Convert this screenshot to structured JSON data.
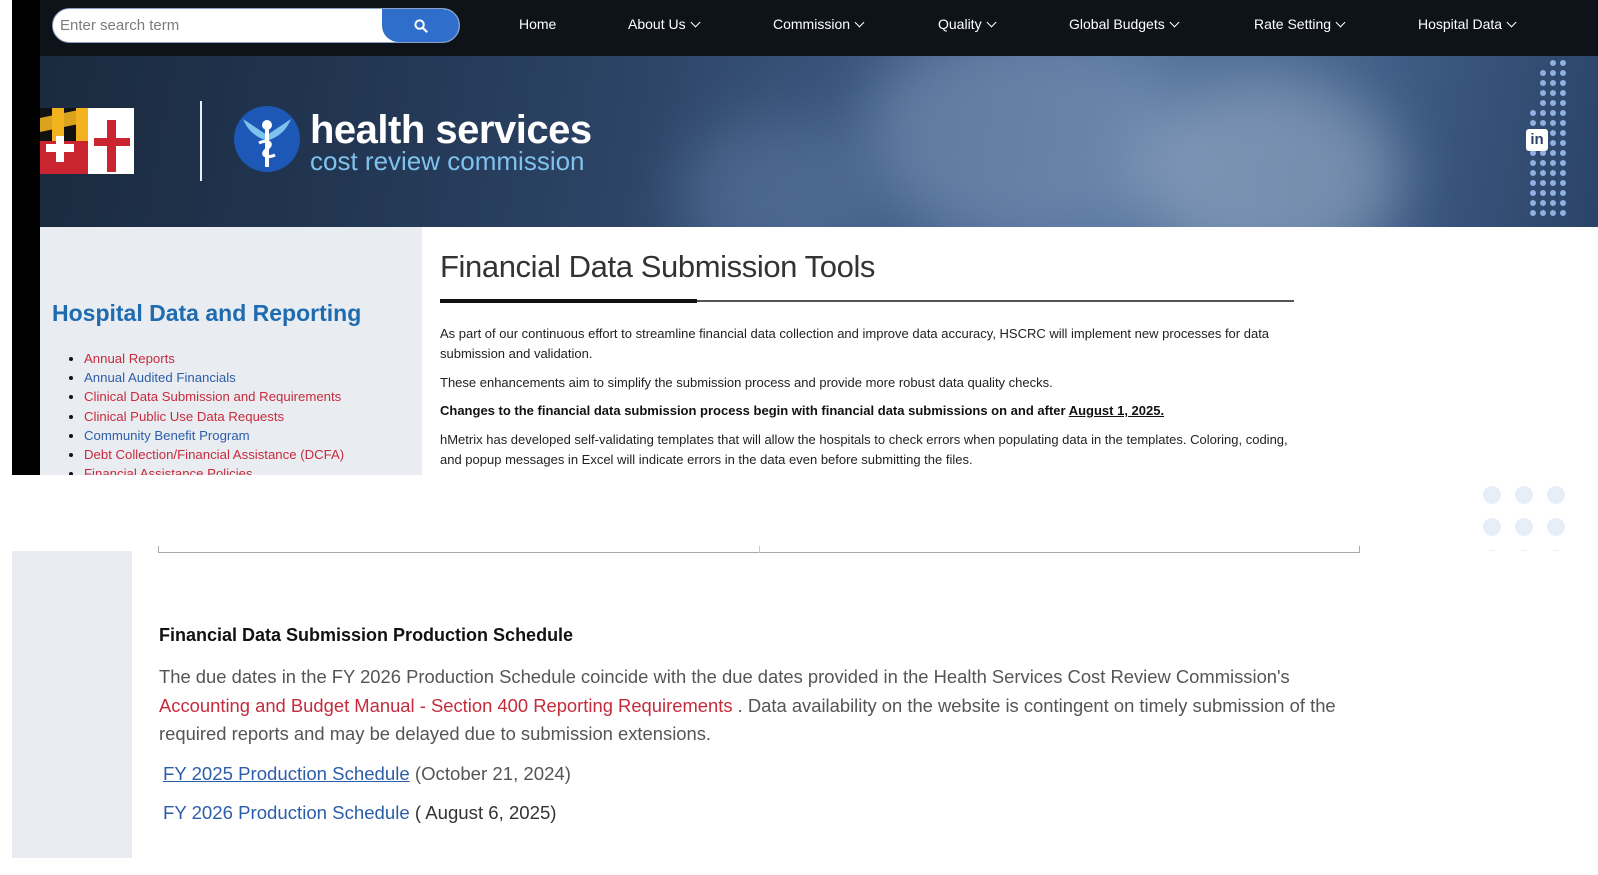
{
  "search": {
    "placeholder": "Enter search term"
  },
  "nav": {
    "items": [
      {
        "label": "Home"
      },
      {
        "label": "About Us"
      },
      {
        "label": "Commission"
      },
      {
        "label": "Quality"
      },
      {
        "label": "Global Budgets"
      },
      {
        "label": "Rate Setting"
      },
      {
        "label": "Hospital Data"
      }
    ]
  },
  "brand": {
    "main": "health services",
    "sub": "cost review commission"
  },
  "sidebar": {
    "title": "Hospital Data and Reporting",
    "items": [
      {
        "label": "Annual Reports",
        "color": "#c62b3d"
      },
      {
        "label": "Annual Audited Financials",
        "color": "#2c5ea8"
      },
      {
        "label": "Clinical Data Submission and Requirements",
        "color": "#c62b3d"
      },
      {
        "label": "Clinical Public Use Data Requests",
        "color": "#c62b3d"
      },
      {
        "label": "Community Benefit Program",
        "color": "#2c5ea8"
      },
      {
        "label": "Debt Collection/Financial Assistance (DCFA)",
        "color": "#c62b3d"
      },
      {
        "label": "Financial Assistance Policies",
        "color": "#c62b3d"
      }
    ]
  },
  "main": {
    "title": "Financial Data Submission Tools",
    "p1": "As part of our continuous effort to streamline financial data collection and improve data accuracy, HSCRC will implement new processes for data submission and validation.",
    "p2": "These enhancements aim to simplify the submission process and provide more robust data quality checks.",
    "p3_text": "Changes to the financial data submission process begin with financial data submissions on and after ",
    "p3_date": "August 1, 2025.",
    "p4": "hMetrix has developed self-validating templates that will allow the hospitals to check errors when populating data in the templates. Coloring, coding, and popup messages in Excel will indicate errors in the data even before submitting the files."
  },
  "schedule": {
    "heading": "Financial Data Submission Production Schedule",
    "desc_before": "The due dates in the FY 2026 Production Schedule coincide with the due dates provided in the Health Services Cost Review Commission's ",
    "desc_link": "Accounting and Budget Manual - Section 400 Reporting Requirements",
    "desc_after": " .  Data availability on the website is contingent on timely submission of the required reports and may be delayed due to submission extensions.",
    "rows": [
      {
        "link": "FY 2025 Production Schedule",
        "date": " (October 21, 2024)"
      },
      {
        "link": "FY 2026 Production Schedule",
        "date": " ( August 6, 2025)"
      }
    ]
  },
  "colors": {
    "nav_bg": "#0d1319",
    "search_button": "#2f6ecb",
    "sidebar_bg": "#e9edf1",
    "sidebar_title": "#1f6bb0",
    "link_red": "#c62b3d",
    "link_blue": "#2c5ea8"
  },
  "icons": {
    "search": "search-icon",
    "flag": "maryland-flag-logo",
    "caduceus": "caduceus-logo",
    "linkedin": "linkedin-icon"
  }
}
